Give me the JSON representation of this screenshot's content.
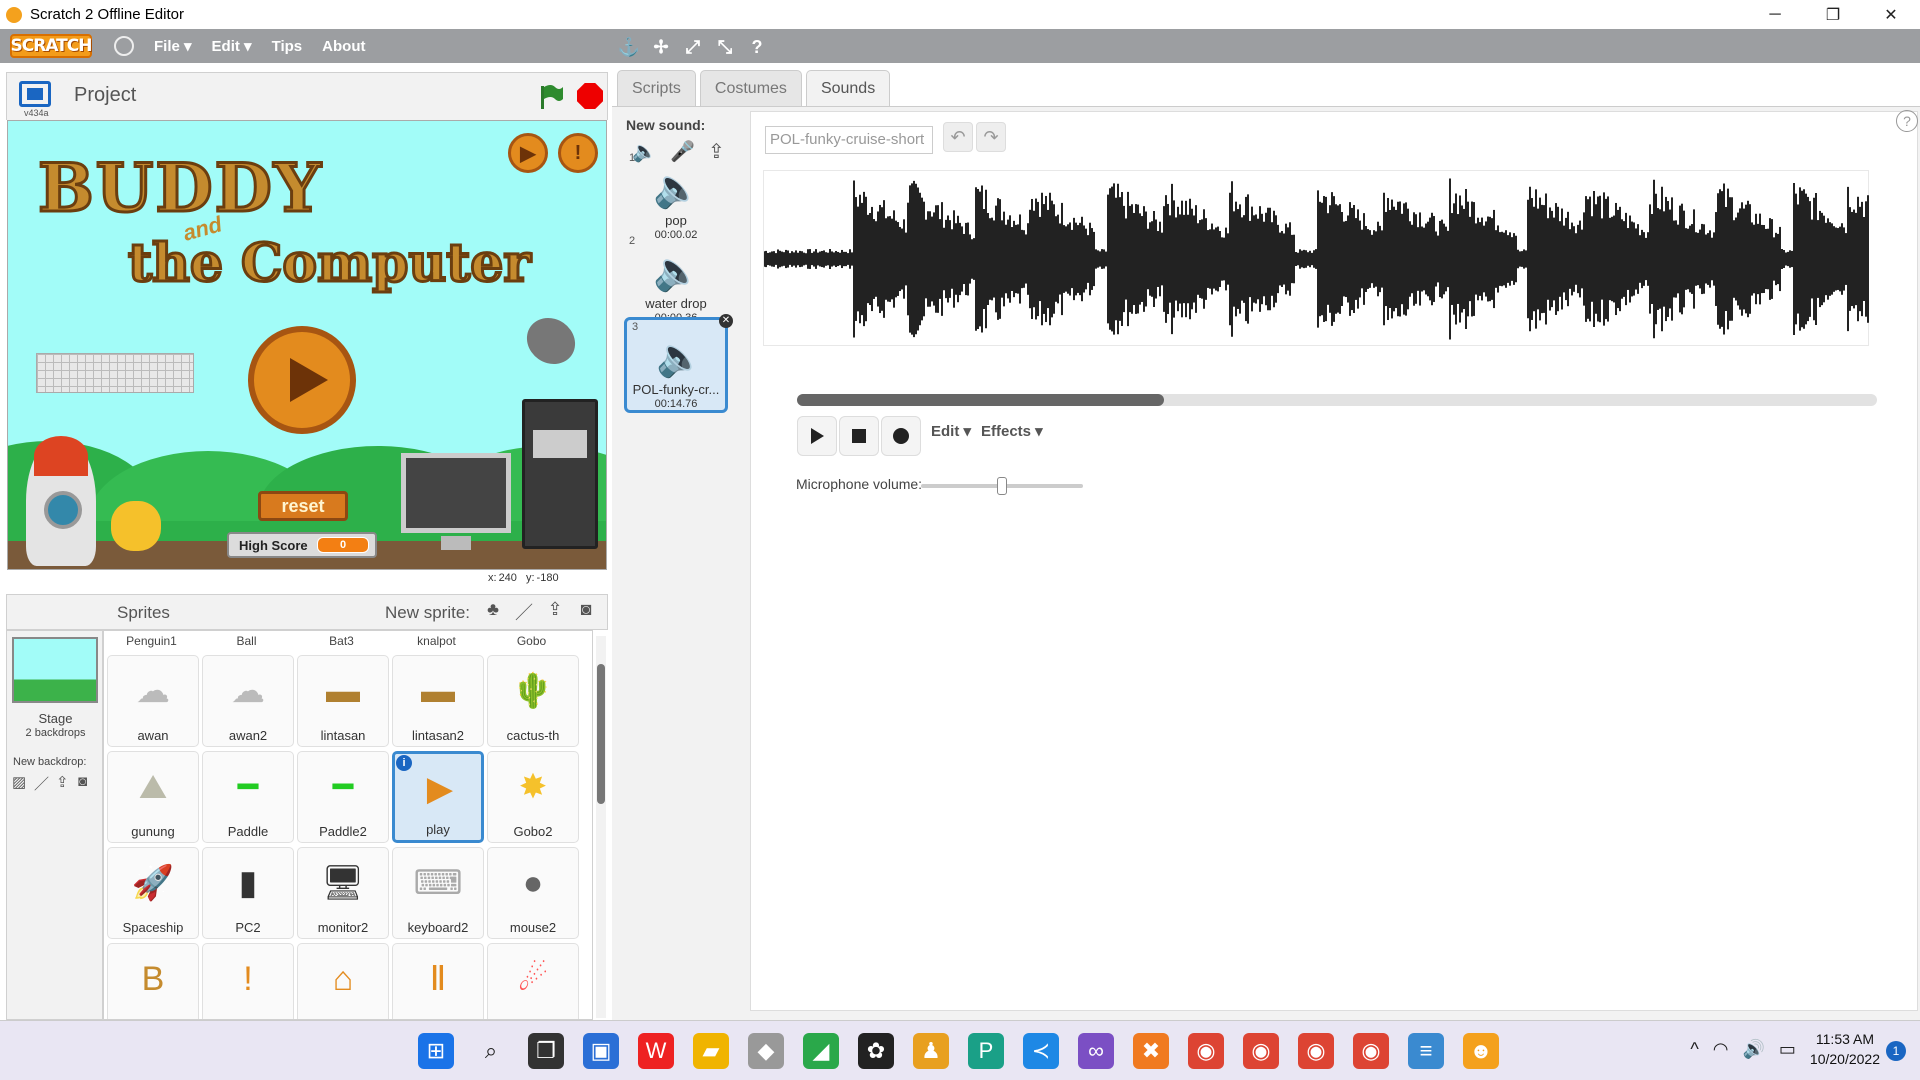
{
  "window": {
    "title": "Scratch 2 Offline Editor",
    "minimize": "─",
    "restore": "❐",
    "close": "✕"
  },
  "menubar": {
    "logo": "SCRATCH",
    "file": "File ▾",
    "edit": "Edit ▾",
    "tips": "Tips",
    "about": "About"
  },
  "toolbar": {
    "duplicate_icon": "⚓",
    "cut_icon": "✢",
    "grow_icon": "⤢",
    "shrink_icon": "⤡",
    "help_icon": "?"
  },
  "stage_header": {
    "version": "v434a",
    "project_name": "Project"
  },
  "stage": {
    "title_line1": "BUDDY",
    "title_and": "and",
    "title_line2": "the Computer",
    "reset_label": "reset",
    "high_score_label": "High Score",
    "high_score_value": "0",
    "topbtn_1": "▶",
    "topbtn_2": "!"
  },
  "coords": {
    "x_label": "x:",
    "x_value": "240",
    "y_label": "y:",
    "y_value": "-180"
  },
  "sprites_panel": {
    "title": "Sprites",
    "new_sprite_label": "New sprite:",
    "stage_label": "Stage",
    "stage_backdrops": "2 backdrops",
    "new_backdrop_label": "New backdrop:",
    "column_names": [
      "Penguin1",
      "Ball",
      "Bat3",
      "knalpot",
      "Gobo"
    ],
    "sprites": [
      {
        "name": "awan",
        "glyph": "☁"
      },
      {
        "name": "awan2",
        "glyph": "☁"
      },
      {
        "name": "lintasan",
        "glyph": "▬"
      },
      {
        "name": "lintasan2",
        "glyph": "▬"
      },
      {
        "name": "cactus-th",
        "glyph": "🌵"
      },
      {
        "name": "gunung",
        "glyph": "⛰"
      },
      {
        "name": "Paddle",
        "glyph": "━"
      },
      {
        "name": "Paddle2",
        "glyph": "━"
      },
      {
        "name": "play",
        "glyph": "▶"
      },
      {
        "name": "Gobo2",
        "glyph": "✸"
      },
      {
        "name": "Spaceship",
        "glyph": "🚀"
      },
      {
        "name": "PC2",
        "glyph": "▮"
      },
      {
        "name": "monitor2",
        "glyph": "🖥"
      },
      {
        "name": "keyboard2",
        "glyph": "⌨"
      },
      {
        "name": "mouse2",
        "glyph": "●"
      },
      {
        "name": "",
        "glyph": "B"
      },
      {
        "name": "",
        "glyph": "!"
      },
      {
        "name": "",
        "glyph": "⌂"
      },
      {
        "name": "",
        "glyph": "Ⅱ"
      },
      {
        "name": "",
        "glyph": "☄"
      }
    ],
    "info_badge": "i"
  },
  "tabs": {
    "scripts": "Scripts",
    "costumes": "Costumes",
    "sounds": "Sounds"
  },
  "sounds": {
    "new_sound_label": "New sound:",
    "list": [
      {
        "num": "1",
        "name": "pop",
        "duration": "00:00.02"
      },
      {
        "num": "2",
        "name": "water drop",
        "duration": "00:00.36"
      },
      {
        "num": "3",
        "name": "POL-funky-cr...",
        "duration": "00:14.76"
      }
    ],
    "selected_name_field": "POL-funky-cruise-short",
    "undo": "↶",
    "redo": "↷",
    "edit_menu": "Edit ▾",
    "effects_menu": "Effects ▾",
    "mic_volume_label": "Microphone volume:",
    "mic_volume_level": 0.5,
    "playhead_scroll_fraction": 0.34
  },
  "help": "?",
  "taskbar": {
    "time": "11:53 AM",
    "date": "10/20/2022",
    "notification_count": "1",
    "tray_up": "^"
  }
}
